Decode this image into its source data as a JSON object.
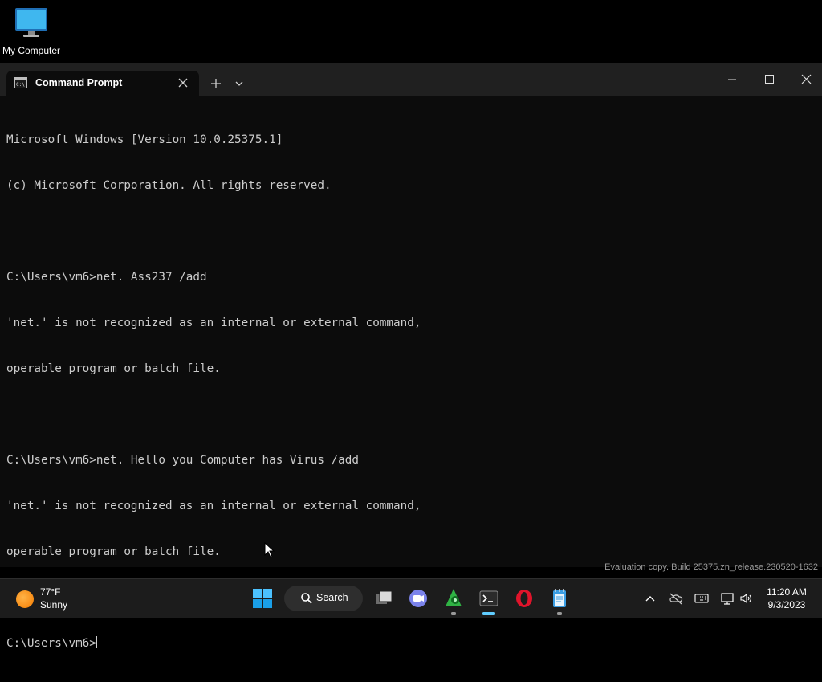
{
  "desktop": {
    "icons": [
      {
        "label": "My Computer",
        "icon": "computer-icon"
      }
    ]
  },
  "window": {
    "tab_title": "Command Prompt",
    "tab_icon": "cmd-icon",
    "new_tab_icon": "plus-icon",
    "dropdown_icon": "chevron-down-icon",
    "controls": [
      "minimize-icon",
      "maximize-icon",
      "close-icon"
    ]
  },
  "console": {
    "lines": [
      "Microsoft Windows [Version 10.0.25375.1]",
      "(c) Microsoft Corporation. All rights reserved.",
      "",
      "C:\\Users\\vm6>net. Ass237 /add",
      "'net.' is not recognized as an internal or external command,",
      "operable program or batch file.",
      "",
      "C:\\Users\\vm6>net. Hello you Computer has Virus /add",
      "'net.' is not recognized as an internal or external command,",
      "operable program or batch file.",
      "",
      "C:\\Users\\vm6>"
    ]
  },
  "watermark": "Evaluation copy. Build 25375.zn_release.230520-1632",
  "taskbar": {
    "weather": {
      "temp": "77°F",
      "condition": "Sunny"
    },
    "search_label": "Search",
    "apps": [
      "start-icon",
      "search-icon",
      "task-view-icon",
      "teams-chat-icon",
      "app-green-icon",
      "terminal-icon",
      "opera-icon",
      "notepad-icon"
    ],
    "tray": [
      "chevron-up-icon",
      "cloud-off-icon",
      "keyboard-icon",
      "network-icon",
      "volume-icon"
    ],
    "clock": {
      "time": "11:20 AM",
      "date": "9/3/2023"
    }
  },
  "colors": {
    "console_bg": "#0c0c0c",
    "titlebar_bg": "#202020",
    "console_text": "#cccccc",
    "accent": "#60cdff"
  }
}
